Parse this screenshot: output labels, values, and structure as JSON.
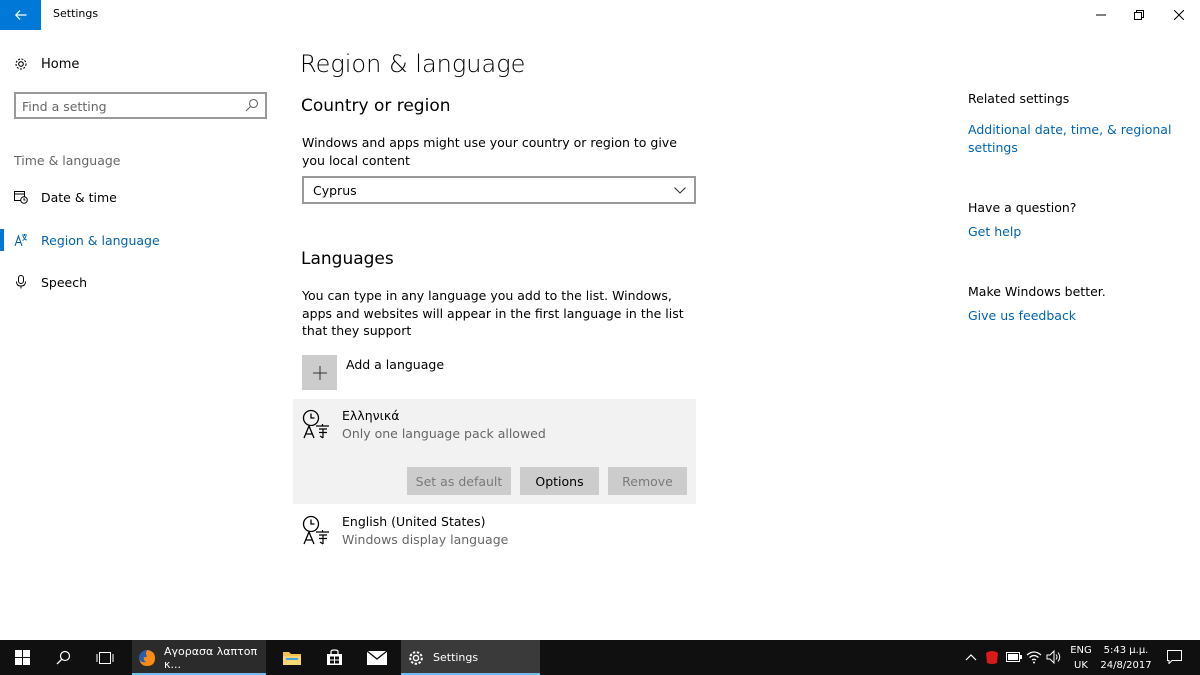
{
  "window": {
    "title": "Settings"
  },
  "sidebar": {
    "home_label": "Home",
    "search_placeholder": "Find a setting",
    "section_label": "Time & language",
    "items": [
      {
        "label": "Date & time",
        "icon": "calendar-clock-icon"
      },
      {
        "label": "Region & language",
        "icon": "region-language-icon",
        "active": true
      },
      {
        "label": "Speech",
        "icon": "microphone-icon"
      }
    ]
  },
  "main": {
    "title": "Region & language",
    "country": {
      "heading": "Country or region",
      "description": "Windows and apps might use your country or region to give you local content",
      "selected": "Cyprus"
    },
    "languages": {
      "heading": "Languages",
      "description": "You can type in any language you add to the list. Windows, apps and websites will appear in the first language in the list that they support",
      "add_label": "Add a language",
      "items": [
        {
          "name": "Ελληνικά",
          "subtitle": "Only one language pack allowed",
          "selected": true
        },
        {
          "name": "English (United States)",
          "subtitle": "Windows display language",
          "selected": false
        }
      ],
      "buttons": {
        "set_default": "Set as default",
        "options": "Options",
        "remove": "Remove"
      }
    }
  },
  "related": {
    "heading": "Related settings",
    "link": "Additional date, time, & regional settings",
    "question_heading": "Have a question?",
    "help_link": "Get help",
    "feedback_heading": "Make Windows better.",
    "feedback_link": "Give us feedback"
  },
  "taskbar": {
    "firefox_label": "Αγορασα λαπτοπ κ...",
    "settings_label": "Settings",
    "lang_line1": "ENG",
    "lang_line2": "UK",
    "time": "5:43 μ.μ.",
    "date": "24/8/2017"
  },
  "colors": {
    "accent": "#0078d7",
    "link": "#0063b1",
    "taskbar": "#101010"
  }
}
